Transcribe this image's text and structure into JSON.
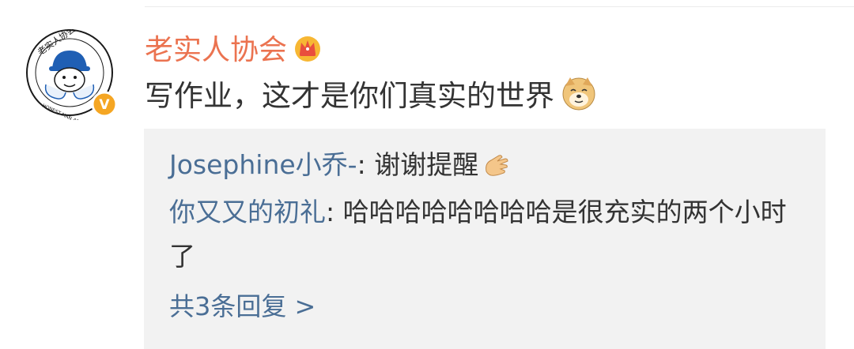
{
  "post": {
    "username": "老实人协会",
    "comment_text": "写作业，这才是你们真实的世界",
    "avatar": {
      "icon": "honest-man-association-logo-icon",
      "logo_text_top": "老实人协会",
      "logo_text_bottom": "HONEST MAN ASSOCIATION",
      "verified_badge": "V"
    },
    "badges": {
      "crown": "crown-icon",
      "emoji": "doge-icon"
    }
  },
  "replies": {
    "items": [
      {
        "author": "Josephine小乔-",
        "separator": ": ",
        "text": "谢谢提醒",
        "emoji": "ok-hand-icon"
      },
      {
        "author": "你又又的初礼",
        "separator": ": ",
        "text": "哈哈哈哈哈哈哈哈是很充实的两个小时了"
      }
    ],
    "more_label": "共3条回复 >"
  },
  "colors": {
    "username": "#eb7350",
    "link": "#4a6e95",
    "text": "#333333",
    "reply_bg": "#f2f2f2",
    "verified": "#f5a623"
  }
}
